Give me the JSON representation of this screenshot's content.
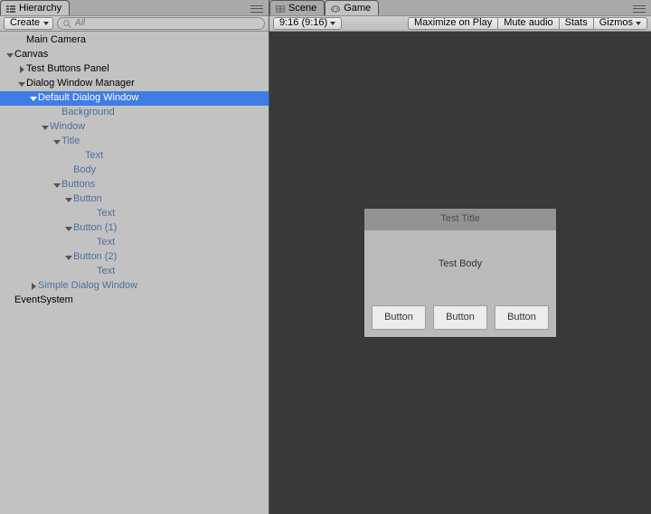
{
  "hierarchy": {
    "tab_label": "Hierarchy",
    "create_label": "Create",
    "search_placeholder": "All",
    "tree": [
      {
        "label": "Main Camera",
        "indent": 1,
        "foldout": "none",
        "prefab": false
      },
      {
        "label": "Canvas",
        "indent": 0,
        "foldout": "down",
        "prefab": false
      },
      {
        "label": "Test Buttons Panel",
        "indent": 1,
        "foldout": "right",
        "prefab": false
      },
      {
        "label": "Dialog Window Manager",
        "indent": 1,
        "foldout": "down",
        "prefab": false
      },
      {
        "label": "Default Dialog Window",
        "indent": 2,
        "foldout": "down",
        "prefab": true,
        "selected": true
      },
      {
        "label": "Background",
        "indent": 4,
        "foldout": "none",
        "prefab": true
      },
      {
        "label": "Window",
        "indent": 3,
        "foldout": "down",
        "prefab": true
      },
      {
        "label": "Title",
        "indent": 4,
        "foldout": "down",
        "prefab": true
      },
      {
        "label": "Text",
        "indent": 6,
        "foldout": "none",
        "prefab": true
      },
      {
        "label": "Body",
        "indent": 5,
        "foldout": "none",
        "prefab": true
      },
      {
        "label": "Buttons",
        "indent": 4,
        "foldout": "down",
        "prefab": true
      },
      {
        "label": "Button",
        "indent": 5,
        "foldout": "down",
        "prefab": true
      },
      {
        "label": "Text",
        "indent": 7,
        "foldout": "none",
        "prefab": true
      },
      {
        "label": "Button (1)",
        "indent": 5,
        "foldout": "down",
        "prefab": true
      },
      {
        "label": "Text",
        "indent": 7,
        "foldout": "none",
        "prefab": true
      },
      {
        "label": "Button (2)",
        "indent": 5,
        "foldout": "down",
        "prefab": true
      },
      {
        "label": "Text",
        "indent": 7,
        "foldout": "none",
        "prefab": true
      },
      {
        "label": "Simple Dialog Window",
        "indent": 2,
        "foldout": "right",
        "prefab": true
      },
      {
        "label": "EventSystem",
        "indent": 0,
        "foldout": "none",
        "prefab": false
      }
    ]
  },
  "game": {
    "scene_tab_label": "Scene",
    "game_tab_label": "Game",
    "aspect_label": "9:16 (9:16)",
    "buttons": {
      "maximize": "Maximize on Play",
      "mute": "Mute audio",
      "stats": "Stats",
      "gizmos": "Gizmos"
    },
    "dialog": {
      "title": "Test Title",
      "body": "Test Body",
      "buttons": [
        "Button",
        "Button",
        "Button"
      ]
    }
  }
}
